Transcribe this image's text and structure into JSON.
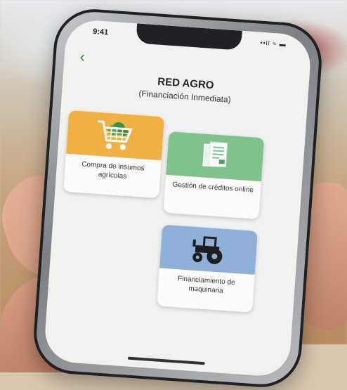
{
  "status": {
    "time": "9:41",
    "icons": "••ll ≈ ▬"
  },
  "header": {
    "back_label": "‹",
    "title": "RED AGRO",
    "subtitle": "(Financiación Inmediata)"
  },
  "cards": [
    {
      "label": "Compra de insumos agrícolas",
      "icon": "shopping-cart-icon",
      "color": "#f1b044"
    },
    {
      "label": "Gestión de créditos online",
      "icon": "document-icon",
      "color": "#7fc28e"
    },
    {
      "label": "Financiamiento de maquinaria",
      "icon": "tractor-icon",
      "color": "#8eb0d8"
    }
  ]
}
